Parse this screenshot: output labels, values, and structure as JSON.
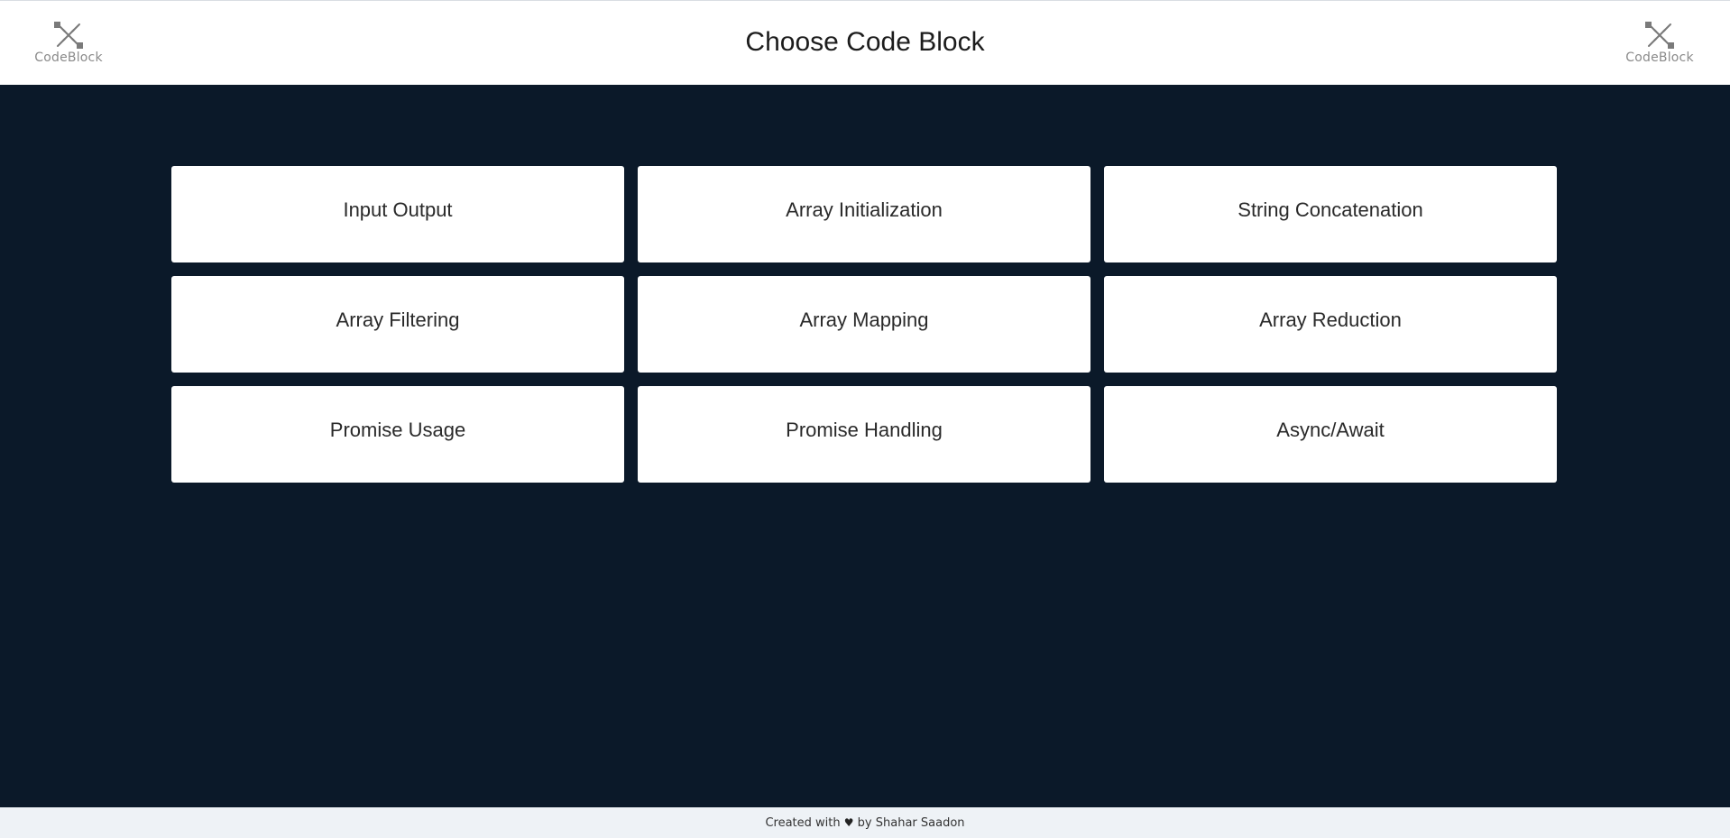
{
  "header": {
    "title": "Choose Code Block",
    "logo_text": "CodeBlock"
  },
  "cards": [
    {
      "label": "Input Output"
    },
    {
      "label": "Array Initialization"
    },
    {
      "label": "String Concatenation"
    },
    {
      "label": "Array Filtering"
    },
    {
      "label": "Array Mapping"
    },
    {
      "label": "Array Reduction"
    },
    {
      "label": "Promise Usage"
    },
    {
      "label": "Promise Handling"
    },
    {
      "label": "Async/Await"
    }
  ],
  "footer": {
    "prefix": "Created with",
    "heart_icon": "heart-icon",
    "heart_glyph": "♥",
    "suffix": "by Shahar Saadon"
  },
  "colors": {
    "background": "#0b1929",
    "card": "#ffffff",
    "footer": "#eef2f6"
  }
}
